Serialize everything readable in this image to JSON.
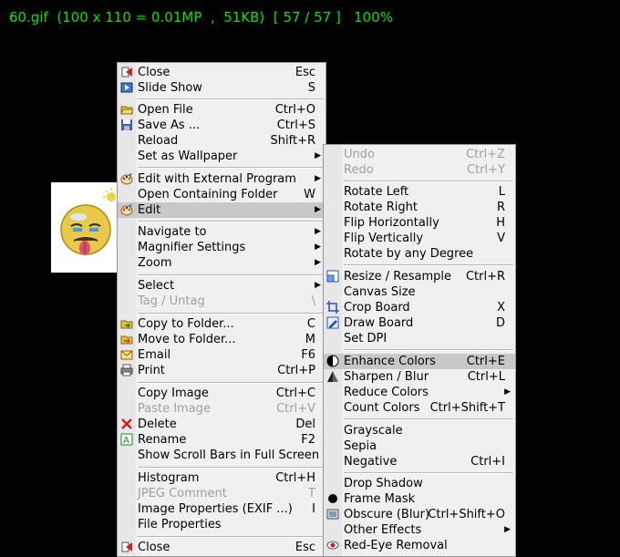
{
  "status_bar": {
    "text": "60.gif  (100 x 110 = 0.01MP  ,  51KB)  [ 57 / 57 ]   100%"
  },
  "main_menu": {
    "items": [
      {
        "label": "Close",
        "shortcut": "Esc",
        "icon": "close-red-icon"
      },
      {
        "label": "Slide Show",
        "shortcut": "S",
        "icon": "slideshow-icon"
      },
      {
        "label": "Open File",
        "shortcut": "Ctrl+O",
        "icon": "open-folder-icon"
      },
      {
        "label": "Save As ...",
        "shortcut": "Ctrl+S",
        "icon": "save-icon"
      },
      {
        "label": "Reload",
        "shortcut": "Shift+R"
      },
      {
        "label": "Set as Wallpaper",
        "submenu": true
      },
      {
        "label": "Edit with External Program",
        "submenu": true,
        "icon": "palette-icon"
      },
      {
        "label": "Open Containing Folder",
        "shortcut": "W"
      },
      {
        "label": "Edit",
        "submenu": true,
        "icon": "palette-icon"
      },
      {
        "label": "Navigate to",
        "submenu": true
      },
      {
        "label": "Magnifier Settings",
        "submenu": true
      },
      {
        "label": "Zoom",
        "submenu": true
      },
      {
        "label": "Select",
        "submenu": true
      },
      {
        "label": "Tag / Untag",
        "shortcut": "\\"
      },
      {
        "label": "Copy to Folder...",
        "shortcut": "C",
        "icon": "copy-folder-icon"
      },
      {
        "label": "Move to Folder...",
        "shortcut": "M",
        "icon": "move-folder-icon"
      },
      {
        "label": "Email",
        "shortcut": "F6",
        "icon": "email-icon"
      },
      {
        "label": "Print",
        "shortcut": "Ctrl+P",
        "icon": "printer-icon"
      },
      {
        "label": "Copy Image",
        "shortcut": "Ctrl+C"
      },
      {
        "label": "Paste Image",
        "shortcut": "Ctrl+V"
      },
      {
        "label": "Delete",
        "shortcut": "Del",
        "icon": "delete-x-icon"
      },
      {
        "label": "Rename",
        "shortcut": "F2",
        "icon": "rename-icon"
      },
      {
        "label": "Show Scroll Bars in Full Screen"
      },
      {
        "label": "Histogram",
        "shortcut": "Ctrl+H"
      },
      {
        "label": "JPEG Comment",
        "shortcut": "T"
      },
      {
        "label": "Image Properties (EXIF ...)",
        "shortcut": "I"
      },
      {
        "label": "File Properties"
      },
      {
        "label": "Close",
        "shortcut": "Esc",
        "icon": "close-red-icon"
      }
    ]
  },
  "edit_menu": {
    "items": [
      {
        "label": "Undo",
        "shortcut": "Ctrl+Z"
      },
      {
        "label": "Redo",
        "shortcut": "Ctrl+Y"
      },
      {
        "label": "Rotate Left",
        "shortcut": "L"
      },
      {
        "label": "Rotate Right",
        "shortcut": "R"
      },
      {
        "label": "Flip Horizontally",
        "shortcut": "H"
      },
      {
        "label": "Flip Vertically",
        "shortcut": "V"
      },
      {
        "label": "Rotate by any Degree"
      },
      {
        "label": "Resize / Resample",
        "shortcut": "Ctrl+R",
        "icon": "resize-icon"
      },
      {
        "label": "Canvas Size"
      },
      {
        "label": "Crop Board",
        "shortcut": "X",
        "icon": "crop-icon"
      },
      {
        "label": "Draw Board",
        "shortcut": "D",
        "icon": "draw-icon"
      },
      {
        "label": "Set DPI"
      },
      {
        "label": "Enhance Colors",
        "shortcut": "Ctrl+E",
        "icon": "contrast-icon"
      },
      {
        "label": "Sharpen / Blur",
        "shortcut": "Ctrl+L",
        "icon": "sharpen-icon"
      },
      {
        "label": "Reduce Colors",
        "submenu": true
      },
      {
        "label": "Count Colors",
        "shortcut": "Ctrl+Shift+T"
      },
      {
        "label": "Grayscale"
      },
      {
        "label": "Sepia"
      },
      {
        "label": "Negative",
        "shortcut": "Ctrl+I"
      },
      {
        "label": "Drop Shadow"
      },
      {
        "label": "Frame Mask",
        "icon": "frame-mask-icon"
      },
      {
        "label": "Obscure (Blur)",
        "shortcut": "Ctrl+Shift+O",
        "icon": "obscure-icon"
      },
      {
        "label": "Other Effects",
        "submenu": true
      },
      {
        "label": "Red-Eye Removal",
        "icon": "red-eye-icon"
      }
    ]
  },
  "colors": {
    "status_text": "#00e600",
    "menu_bg": "#f0f0f0",
    "highlight": "#c8c8c8",
    "disabled": "#a0a0a0"
  }
}
